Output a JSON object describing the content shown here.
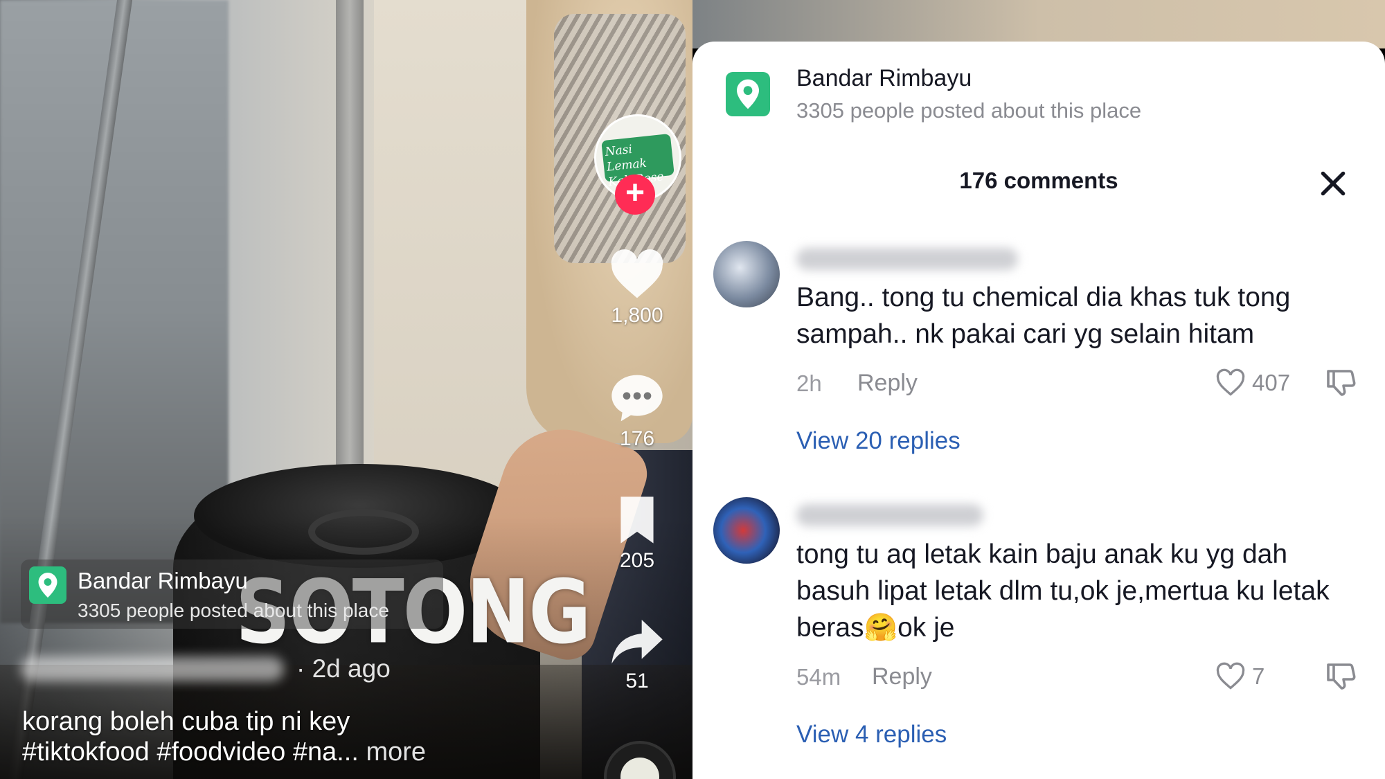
{
  "video": {
    "overlay_text": "SOTONG",
    "creator_avatar_text": "Nasi Lemak Kak Rose",
    "follow_symbol": "+",
    "likes": "1,800",
    "comments": "176",
    "saves": "205",
    "shares": "51",
    "location": {
      "title": "Bandar Rimbayu",
      "subtitle": "3305 people posted about this place"
    },
    "posted": "· 2d ago",
    "caption_line1": "korang boleh cuba tip ni key",
    "caption_line2": "#tiktokfood #foodvideo  #na...",
    "caption_more": "more"
  },
  "sheet": {
    "location": {
      "title": "Bandar Rimbayu",
      "subtitle": "3305 people posted about this place"
    },
    "comment_count": "176 comments",
    "comments": [
      {
        "text": "Bang.. tong tu chemical dia khas tuk tong sampah.. nk pakai cari yg selain hitam",
        "time": "2h",
        "reply_label": "Reply",
        "likes": "407",
        "view_replies": "View 20 replies"
      },
      {
        "text": "tong tu aq letak kain baju anak ku yg dah basuh lipat letak dlm tu,ok je,mertua ku letak beras🤗ok je",
        "time": "54m",
        "reply_label": "Reply",
        "likes": "7",
        "view_replies": "View 4 replies"
      }
    ]
  },
  "colors": {
    "accent_green": "#2dbd7e",
    "follow_red": "#ff2c55",
    "link_blue": "#2b5fb3"
  }
}
